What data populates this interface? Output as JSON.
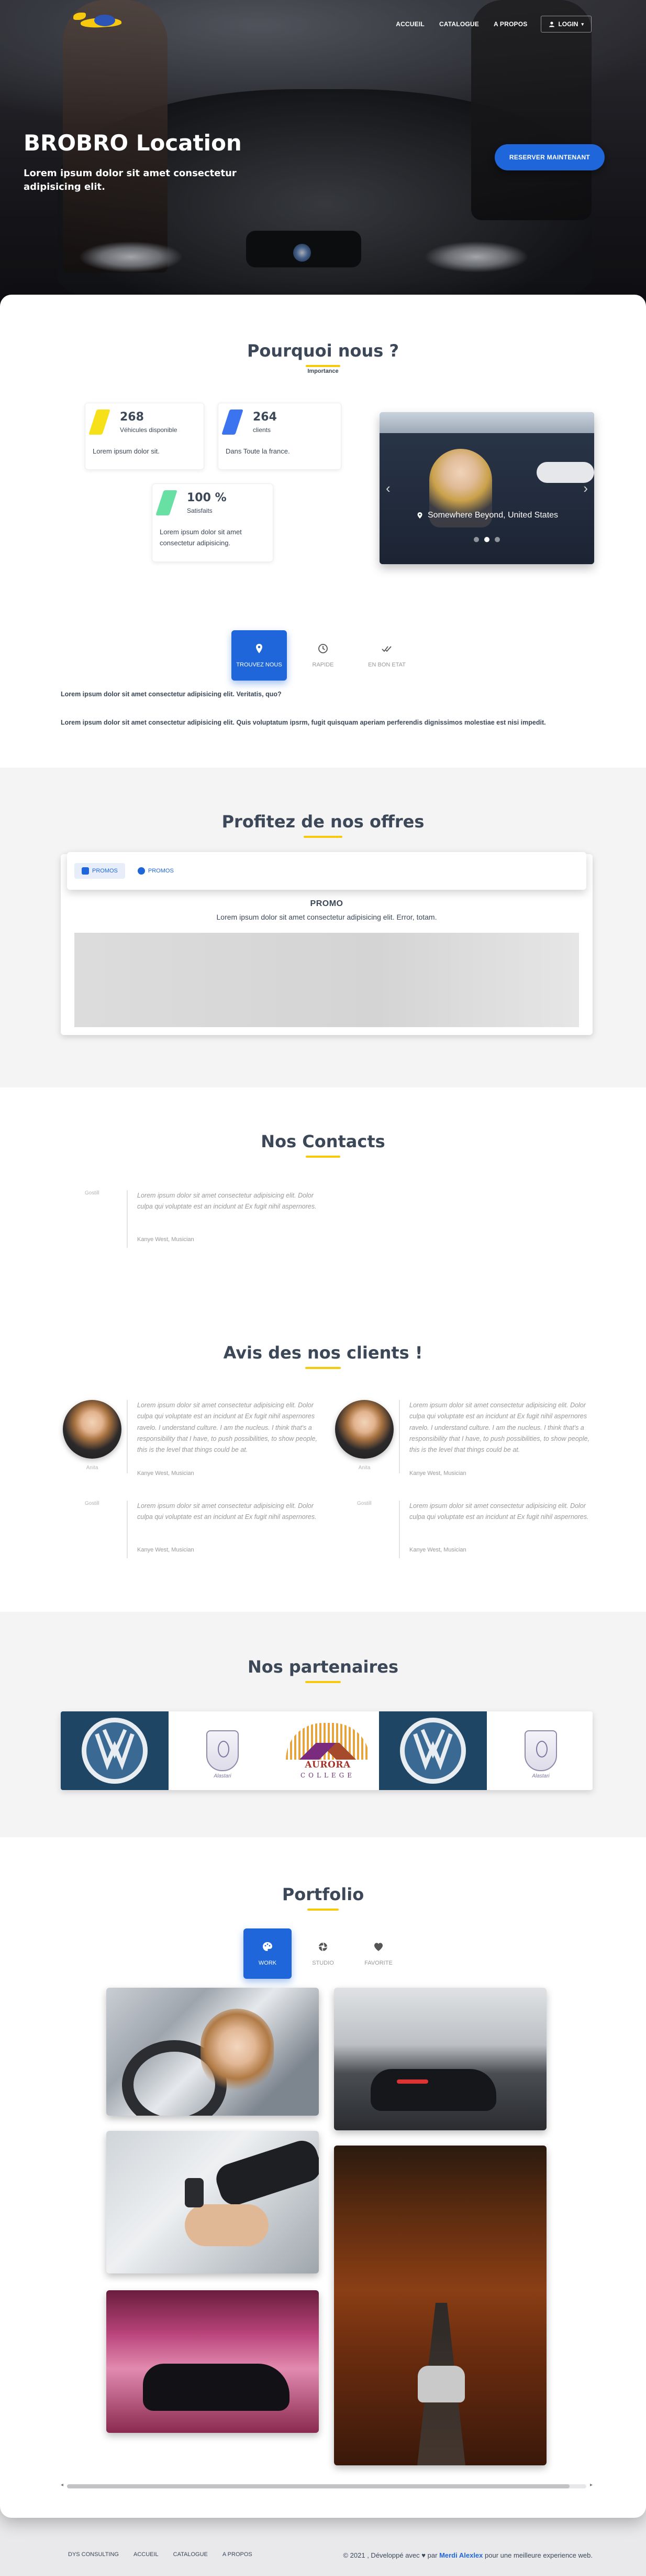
{
  "nav": {
    "links": [
      "ACCUEIL",
      "CATALOGUE",
      "A PROPOS"
    ],
    "login_label": "LOGIN"
  },
  "hero": {
    "title": "BROBRO Location",
    "subtitle": "Lorem ipsum dolor sit amet consectetur adipisicing elit.",
    "cta_label": "RESERVER MAINTENANT"
  },
  "why": {
    "title": "Pourquoi nous ?",
    "subtitle": "Importance",
    "stats": [
      {
        "value": "268",
        "label": "Véhicules disponible",
        "desc": "Lorem ipsum dolor sit.",
        "color": "#f6e01a"
      },
      {
        "value": "264",
        "label": "clients",
        "desc": "Dans Toute la france.",
        "color": "#3c74f0"
      },
      {
        "value": "100 %",
        "label": "Satisfaits",
        "desc": "Lorem ipsum dolor sit amet consectetur adipisicing.",
        "color": "#68e0a3"
      }
    ],
    "carousel_caption": "Somewhere Beyond, United States",
    "tabs": [
      "TROUVEZ NOUS",
      "RAPIDE",
      "EN BON ETAT"
    ],
    "para1": "Lorem ipsum dolor sit amet consectetur adipisicing elit. Veritatis, quo?",
    "para2": "Lorem ipsum dolor sit amet consectetur adipisicing elit. Quis voluptatum ipsrm, fugit quisquam aperiam perferendis dignissimos molestiae est nisi impedit."
  },
  "offers": {
    "title": "Profitez de nos offres",
    "pills": [
      "PROMOS",
      "PROMOS"
    ],
    "promo_title": "PROMO",
    "promo_desc": "Lorem ipsum dolor sit amet consectetur adipisicing elit. Error, totam."
  },
  "contacts": {
    "title": "Nos Contacts",
    "item": {
      "date": "Gostill",
      "text": "Lorem ipsum dolor sit amet consectetur adipisicing elit. Dolor culpa qui voluptate est an incidunt at Ex fugit nihil aspernores.",
      "author": "Kanye West, Musician"
    }
  },
  "reviews": {
    "title": "Avis des nos clients !",
    "long_text": "Lorem ipsum dolor sit amet consectetur adipisicing elit. Dolor culpa qui voluptate est an incidunt at Ex fugit nihil aspernores ravelo. I understand culture. I am the nucleus. I think that's a responsibility that I have, to push possibilities, to show people, this is the level that things could be at.",
    "short_text": "Lorem ipsum dolor sit amet consectetur adipisicing elit. Dolor culpa qui voluptate est an incidunt at Ex fugit nihil aspernores.",
    "author": "Kanye West, Musician",
    "avatar_name": "Anita",
    "date": "Gostill"
  },
  "partners": {
    "title": "Nos partenaires",
    "aurora_word": "AURORA",
    "aurora_college": "COLLEGE",
    "bentley_word": "Alastari"
  },
  "portfolio": {
    "title": "Portfolio",
    "tabs": [
      "WORK",
      "STUDIO",
      "FAVORITE"
    ]
  },
  "footer": {
    "links": [
      "DYS CONSULTING",
      "ACCUEIL",
      "CATALOGUE",
      "A PROPOS"
    ],
    "copy_prefix": "© 2021 , Développé avec",
    "copy_mid": "par",
    "author": "Merdi Alexlex",
    "copy_suffix": "pour une meilleure experience web."
  },
  "colors": {
    "accent": "#1e66d9",
    "yellow": "#f6c90e",
    "text": "#3c4858"
  }
}
